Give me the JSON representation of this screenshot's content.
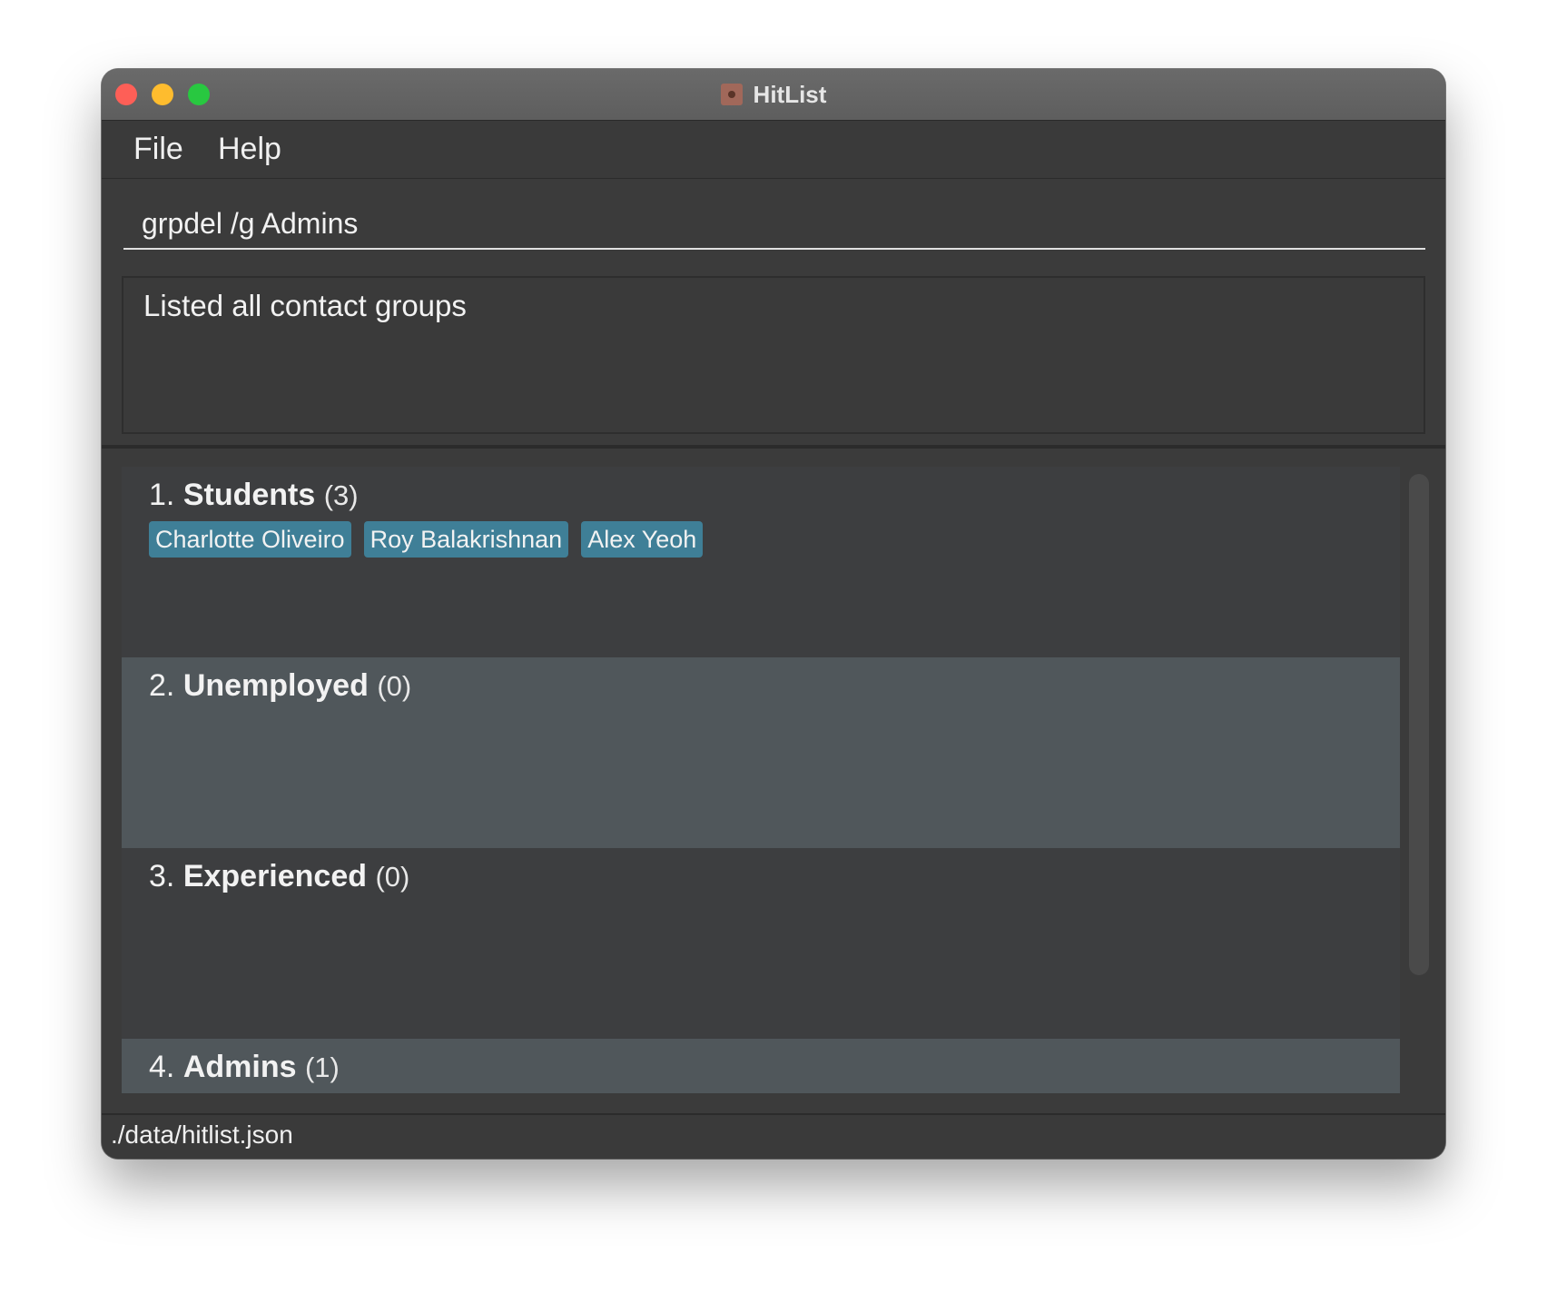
{
  "window": {
    "title": "HitList",
    "icon": "hitlist-app-icon"
  },
  "menubar": {
    "items": [
      {
        "label": "File"
      },
      {
        "label": "Help"
      }
    ]
  },
  "command": {
    "value": "grpdel /g Admins"
  },
  "result": {
    "message": "Listed all contact groups"
  },
  "groups": [
    {
      "index": "1.",
      "name": "Students",
      "count": "(3)",
      "members": [
        "Charlotte Oliveiro",
        "Roy Balakrishnan",
        "Alex Yeoh"
      ]
    },
    {
      "index": "2.",
      "name": "Unemployed",
      "count": "(0)",
      "members": []
    },
    {
      "index": "3.",
      "name": "Experienced",
      "count": "(0)",
      "members": []
    },
    {
      "index": "4.",
      "name": "Admins",
      "count": "(1)",
      "members": []
    }
  ],
  "status": {
    "path": "./data/hitlist.json"
  },
  "colors": {
    "tag": "#3f7f97",
    "card_odd": "#3d3e40",
    "card_even": "#50575b",
    "background": "#3b3b3b"
  }
}
